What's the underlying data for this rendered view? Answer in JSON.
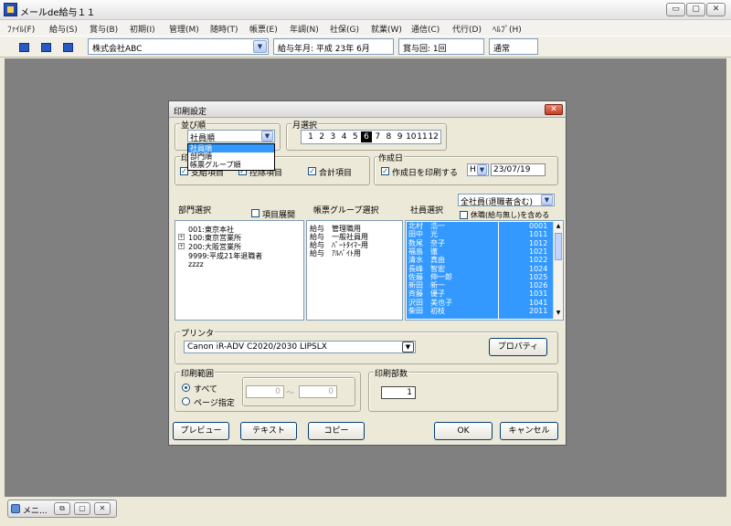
{
  "window": {
    "title": "メールde給与１１",
    "min": "▭",
    "max": "▢",
    "close": "✕"
  },
  "menu": [
    "ﾌｧｲﾙ(F)",
    "給与(S)",
    "賞与(B)",
    "初期(I)",
    "管理(M)",
    "随時(T)",
    "帳票(E)",
    "年調(N)",
    "社保(G)",
    "就業(W)",
    "通信(C)",
    "代行(D)",
    "ﾍﾙﾌﾟ(H)"
  ],
  "toolbar": {
    "company": "株式会社ABC",
    "pay_month": "給与年月: 平成 23年  6月",
    "bonus_round": "賞与回: 1回",
    "mode": "通常"
  },
  "taskbar": {
    "mini_window": "メニ..."
  },
  "dialog": {
    "title": "印刷設定",
    "close": "✕",
    "sort": {
      "label": "並び順",
      "value": "社員順",
      "options": [
        "社員順",
        "部門順",
        "帳票グループ順"
      ]
    },
    "months": {
      "label": "月選択",
      "items": [
        "1",
        "2",
        "3",
        "4",
        "5",
        "6",
        "7",
        "8",
        "9",
        "10",
        "11",
        "12"
      ],
      "selected": "6"
    },
    "print_items": {
      "label": "印",
      "opt1": "支給項目",
      "opt2": "控除項目",
      "opt3": "合計項目"
    },
    "creation_date": {
      "label": "作成日",
      "print_label": "作成日を印刷する",
      "era": "H",
      "date": "23/07/19"
    },
    "department": {
      "label": "部門選択",
      "expand_label": "項目展開",
      "items": [
        "001:東京本社",
        "100:東京営業所",
        "200:大阪営業所",
        "9999:平成21年退職者",
        "zzzz"
      ]
    },
    "form_group": {
      "label": "帳票グループ選択",
      "items": [
        "給与　管理職用",
        "給与　一般社員用",
        "給与　ﾊﾟｰﾄﾀｲﾏｰ用",
        "給与　ｱﾙﾊﾞｲﾄ用"
      ]
    },
    "employee": {
      "label": "社員選択",
      "filter": "全社員(退職者含む)",
      "leave_label": "休職(給与無し)を含める",
      "rows": [
        [
          "北村　浩一",
          "0001"
        ],
        [
          "田中　光",
          "1011"
        ],
        [
          "数尾　奈子",
          "1012"
        ],
        [
          "福島　徹",
          "1021"
        ],
        [
          "清水　真由",
          "1022"
        ],
        [
          "長峰　智宏",
          "1024"
        ],
        [
          "佐藤　伸一郎",
          "1025"
        ],
        [
          "新田　新一",
          "1026"
        ],
        [
          "斉藤　優子",
          "1031"
        ],
        [
          "沢田　美也子",
          "1041"
        ],
        [
          "柴田　初枝",
          "2011"
        ]
      ]
    },
    "printer": {
      "label": "プリンタ",
      "value": "Canon iR-ADV C2020/2030 LIPSLX",
      "properties": "プロパティ"
    },
    "range": {
      "label": "印刷範囲",
      "all": "すべて",
      "page": "ページ指定",
      "from": "0",
      "tilde": "～",
      "to": "0"
    },
    "copies": {
      "label": "印刷部数",
      "value": "1"
    },
    "buttons": {
      "preview": "プレビュー",
      "text": "テキスト",
      "copy": "コピー",
      "ok": "OK",
      "cancel": "キャンセル"
    }
  }
}
